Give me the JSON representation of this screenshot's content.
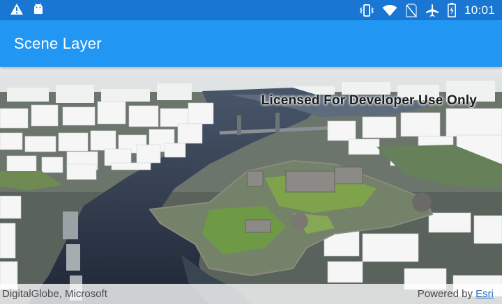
{
  "status_bar": {
    "time": "10:01",
    "icons": [
      "warning-icon",
      "android-icon",
      "vibrate-icon",
      "wifi-icon",
      "no-sim-icon",
      "airplane-icon",
      "battery-charging-icon"
    ]
  },
  "app_bar": {
    "title": "Scene Layer"
  },
  "map": {
    "watermark": "Licensed For Developer Use Only",
    "attribution": "DigitalGlobe, Microsoft",
    "powered_by": "Powered by ",
    "powered_by_link": "Esri"
  },
  "colors": {
    "status_bar": "#1976d2",
    "app_bar": "#2196f3",
    "water": "#2a3344",
    "land": "#6f7a70",
    "grass": "#6f9a45",
    "buildings": "#f4f4f4"
  }
}
